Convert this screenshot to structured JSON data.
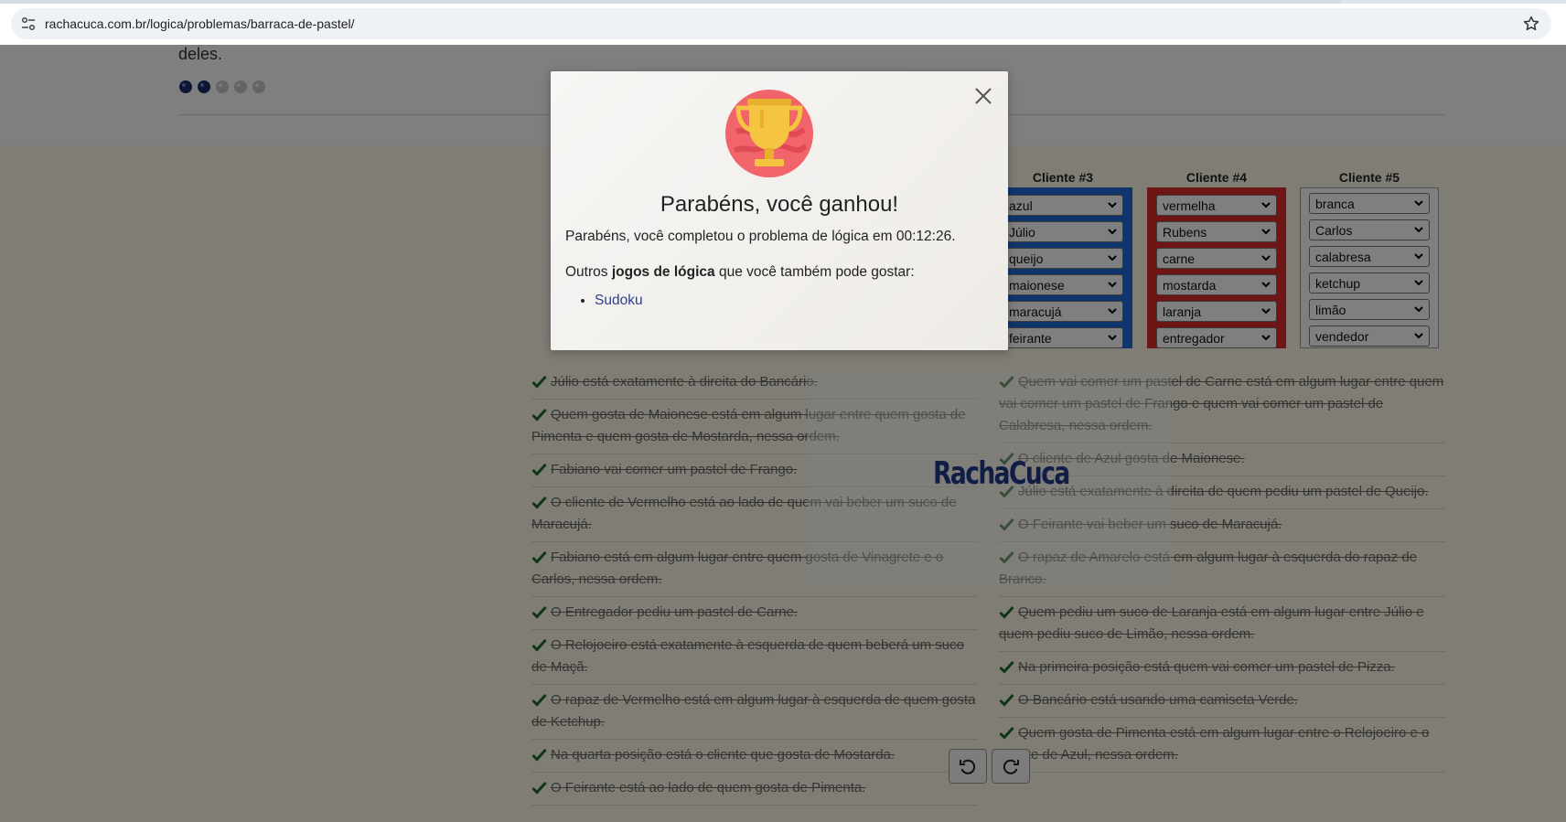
{
  "browser": {
    "url": "rachacuca.com.br/logica/problemas/barraca-de-pastel/"
  },
  "page": {
    "intro_tail": "deles.",
    "difficulty": {
      "level": 2,
      "max": 5
    },
    "clients": [
      {
        "title": "Cliente #3",
        "values": [
          "azul",
          "Júlio",
          "queijo",
          "maionese",
          "maracujá",
          "feirante"
        ]
      },
      {
        "title": "Cliente #4",
        "values": [
          "vermelha",
          "Rubens",
          "carne",
          "mostarda",
          "laranja",
          "entregador"
        ]
      },
      {
        "title": "Cliente #5",
        "values": [
          "branca",
          "Carlos",
          "calabresa",
          "ketchup",
          "limão",
          "vendedor"
        ]
      }
    ],
    "clues_left": [
      "Júlio está exatamente à direita do Bancário.",
      "Quem gosta de Maionese está em algum lugar entre quem gosta de Pimenta e quem gosta de Mostarda, nessa ordem.",
      "Fabiano vai comer um pastel de Frango.",
      "O cliente de Vermelho está ao lado de quem vai beber um suco de Maracujá.",
      "Fabiano está em algum lugar entre quem gosta de Vinagrete e o Carlos, nessa ordem.",
      "O Entregador pediu um pastel de Carne.",
      "O Relojoeiro está exatamente à esquerda de quem beberá um suco de Maçã.",
      "O rapaz de Vermelho está em algum lugar à esquerda de quem gosta de Ketchup.",
      "Na quarta posição está o cliente que gosta de Mostarda.",
      "O Feirante está ao lado de quem gosta de Pimenta."
    ],
    "clues_right": [
      "Quem vai comer um pastel de Carne está em algum lugar entre quem vai comer um pastel de Frango e quem vai comer um pastel de Calabresa, nessa ordem.",
      "O cliente de Azul gosta de Maionese.",
      "Júlio está exatamente à direita de quem pediu um pastel de Queijo.",
      "O Feirante vai beber um suco de Maracujá.",
      "O rapaz de Amarelo está em algum lugar à esquerda do rapaz de Branco.",
      "Quem pediu um suco de Laranja está em algum lugar entre Júlio e quem pediu suco de Limão, nessa ordem.",
      "Na primeira posição está quem vai comer um pastel de Pizza.",
      "O Bancário está usando uma camiseta Verde.",
      "Quem gosta de Pimenta está em algum lugar entre o Relojoeiro e o cliente de Azul, nessa ordem."
    ],
    "watermark": {
      "part1": "Racha",
      "part2": "Cuca"
    }
  },
  "modal": {
    "title": "Parabéns, você ganhou!",
    "message": "Parabéns, você completou o problema de lógica em 00:12:26.",
    "other_prefix": "Outros ",
    "other_bold": "jogos de lógica",
    "other_suffix": " que você também pode gostar:",
    "links": [
      "Sudoku"
    ]
  },
  "colors": {
    "overlay": "rgba(0,0,0,0.5)",
    "link": "#2c3f8f",
    "check": "#1e6b2e",
    "client3_border": "#1e6cd8",
    "client4_border": "#dc2b2b"
  },
  "icons": {
    "site_info": "tune-icon",
    "bookmark": "star-icon",
    "close": "close-icon",
    "trophy": "trophy-icon",
    "check": "check-icon",
    "undo": "undo-icon",
    "redo": "redo-icon",
    "select_arrow": "chevron-down-icon"
  }
}
